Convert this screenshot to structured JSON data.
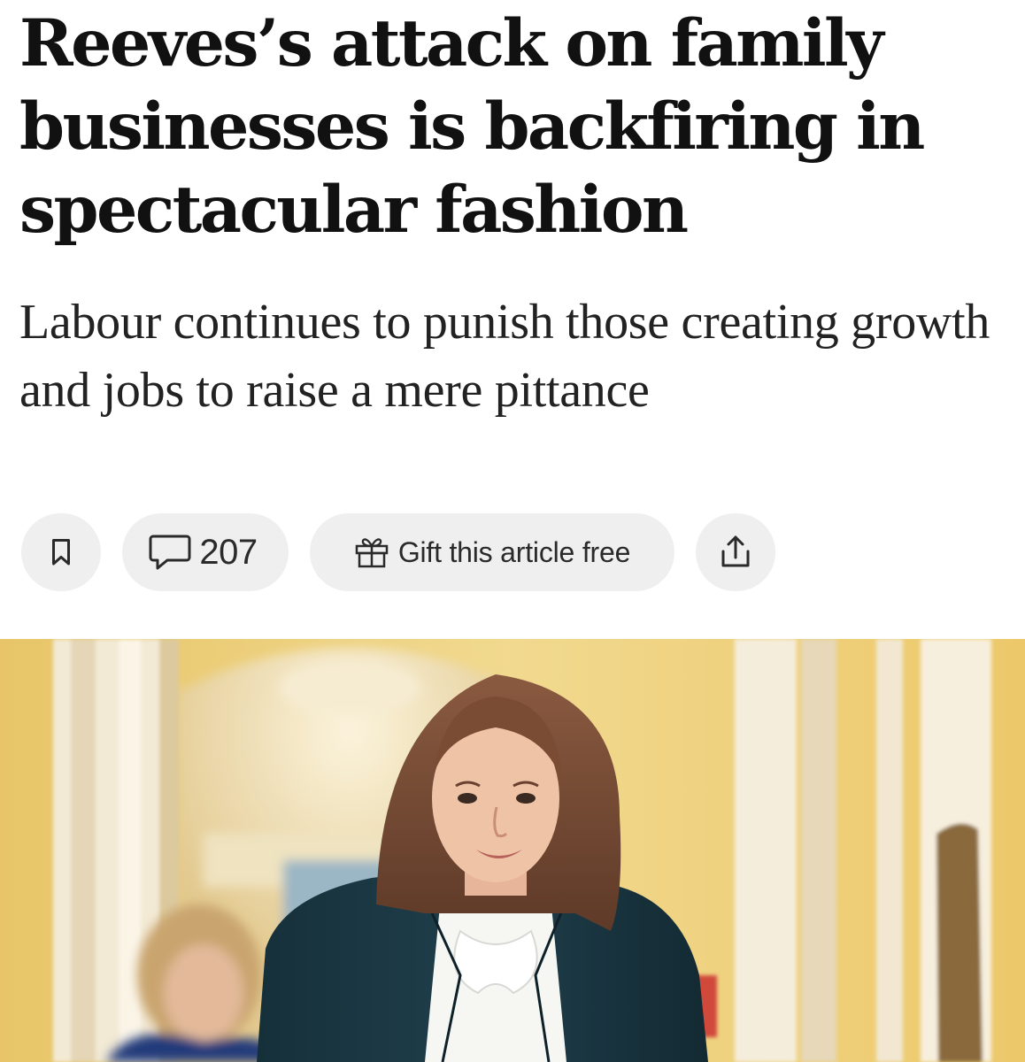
{
  "article": {
    "headline": "Reeves’s attack on family businesses is backfiring in spectacular fashion",
    "standfirst": "Labour continues to punish those creating growth and jobs to raise a mere pittance"
  },
  "toolbar": {
    "bookmark_icon": "bookmark-icon",
    "comment_icon": "comment-icon",
    "comment_count": "207",
    "gift_icon": "gift-icon",
    "gift_label": "Gift this article free",
    "share_icon": "share-icon"
  },
  "colors": {
    "button_bg": "#efefef",
    "text": "#111111"
  }
}
